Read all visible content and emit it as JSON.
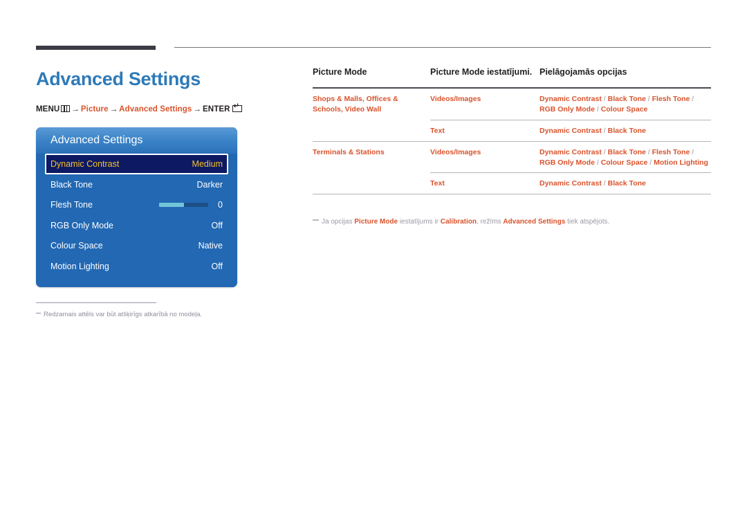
{
  "page": {
    "title": "Advanced Settings",
    "breadcrumb": {
      "menu_label": "MENU",
      "menu_icon": "menu-bars-icon",
      "arrow": "→",
      "step1": "Picture",
      "step2": "Advanced Settings",
      "enter_label": "ENTER",
      "enter_icon": "enter-key-icon"
    },
    "left_note": "Redzamais attēls var būt atšķirīgs atkarībā no modeļa."
  },
  "osd": {
    "title": "Advanced Settings",
    "rows": [
      {
        "label": "Dynamic Contrast",
        "value": "Medium",
        "selected": true,
        "type": "value"
      },
      {
        "label": "Black Tone",
        "value": "Darker",
        "selected": false,
        "type": "value"
      },
      {
        "label": "Flesh Tone",
        "value": "0",
        "selected": false,
        "type": "slider",
        "slider_fill_percent": 50
      },
      {
        "label": "RGB Only Mode",
        "value": "Off",
        "selected": false,
        "type": "value"
      },
      {
        "label": "Colour Space",
        "value": "Native",
        "selected": false,
        "type": "value"
      },
      {
        "label": "Motion Lighting",
        "value": "Off",
        "selected": false,
        "type": "value"
      }
    ]
  },
  "table": {
    "headers": {
      "col1": "Picture Mode",
      "col2": "Picture Mode iestatījumi.",
      "col3": "Pielāgojamās opcijas"
    },
    "rows": [
      {
        "col1": "Shops & Malls, Offices & Schools, Video Wall",
        "col2": "Videos/Images",
        "col3": "Dynamic Contrast / Black Tone / Flesh Tone / RGB Only Mode / Colour Space"
      },
      {
        "col1": "",
        "col2": "Text",
        "col3": "Dynamic Contrast / Black Tone"
      },
      {
        "col1": "Terminals & Stations",
        "col2": "Videos/Images",
        "col3": "Dynamic Contrast / Black Tone / Flesh Tone / RGB Only Mode / Colour Space / Motion Lighting"
      },
      {
        "col1": "",
        "col2": "Text",
        "col3": "Dynamic Contrast / Black Tone"
      }
    ],
    "note": {
      "part1": "Ja opcijas ",
      "bold1": "Picture Mode",
      "part2": " iestatījums ir ",
      "bold2": "Calibration",
      "part3": ", režīms ",
      "bold3": "Advanced Settings",
      "part4": " tiek atspējots."
    }
  },
  "colors": {
    "title_blue": "#2e7ab8",
    "accent_orange": "#d9532c",
    "osd_blue": "#2268b3",
    "osd_selected_navy": "#0d1a63",
    "osd_selected_text": "#f7c12a",
    "rule_dark": "#3b3a45",
    "note_gray": "#8f8d9c"
  }
}
